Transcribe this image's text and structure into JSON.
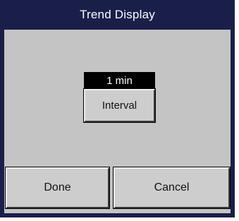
{
  "dialog": {
    "title": "Trend Display",
    "interval": {
      "value": "1 min",
      "label": "Interval"
    },
    "buttons": {
      "done_label": "Done",
      "cancel_label": "Cancel"
    }
  },
  "colors": {
    "frame": "#1a1f4a",
    "panel": "#c4c4c4",
    "button_face": "#cdcdcd",
    "value_background": "#000000",
    "title_text": "#ffffff"
  }
}
